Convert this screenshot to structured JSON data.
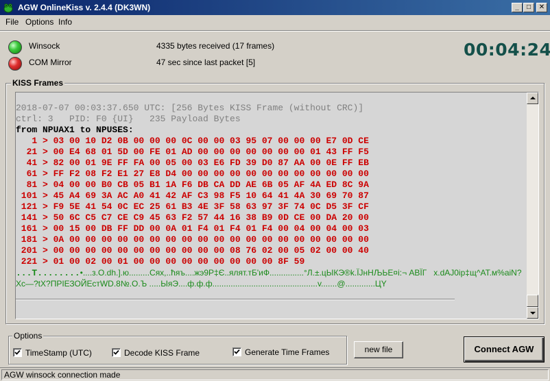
{
  "window": {
    "title": "AGW OnlineKiss v. 2.4.4  (DK3WN)",
    "minimize": "_",
    "maximize": "□",
    "close": "✕"
  },
  "menu": {
    "file": "File",
    "options": "Options",
    "info": "Info"
  },
  "status": {
    "winsock_label": "Winsock",
    "winsock_info": "4335 bytes received (17 frames)",
    "com_label": "COM Mirror",
    "com_info": "47 sec since last packet [5]",
    "timer": "00:04:24",
    "winsock_color": "#3cc83c",
    "com_color": "#e03030"
  },
  "kiss": {
    "title": "KISS Frames",
    "header_line": "2018-07-07 00:03:37.650 UTC: [256 Bytes KISS Frame (without CRC)]",
    "ctrl_line": "ctrl: 3   PID: F0 {UI}   235 Payload Bytes",
    "from_line": "from NPUAX1 to NPUSES:",
    "hex_rows": [
      "   1 > 03 00 10 D2 0B 00 00 00 0C 00 00 03 95 07 00 00 00 E7 0D CE",
      "  21 > 00 E4 68 01 5D 00 FE 01 AD 00 00 00 00 00 00 00 01 43 FF F5",
      "  41 > 82 00 01 9E FF FA 00 05 00 03 E6 FD 39 D0 87 AA 00 0E FF EB",
      "  61 > FF F2 08 F2 E1 27 E8 D4 00 00 00 00 00 00 00 00 00 00 00 00",
      "  81 > 04 00 00 B0 CB 05 B1 1A F6 DB CA DD AE 6B 05 AF 4A ED 8C 9A",
      " 101 > 45 A4 69 3A AC A0 41 42 AF C3 98 F5 10 64 41 4A 30 69 70 87",
      " 121 > F9 5E 41 54 0C EC 25 61 B3 4E 3F 58 63 97 3F 74 0C D5 3F CF",
      " 141 > 50 6C C5 C7 CE C9 45 63 F2 57 44 16 38 B9 0D CE 00 DA 20 00",
      " 161 > 00 15 00 DB FF DD 00 0A 01 F4 01 F4 01 F4 00 04 00 04 00 03",
      " 181 > 0A 00 00 00 00 00 00 00 00 00 00 00 00 00 00 00 00 00 00 00",
      " 201 > 00 00 00 00 00 00 00 00 00 00 00 08 76 02 00 05 02 00 00 40",
      " 221 > 01 00 02 00 01 00 00 00 00 00 00 00 00 00 8F 59"
    ],
    "ascii_line1_start": "...T........",
    "ascii_line1_rest": "•....з.О.dh.].ю.........Сях,..ћяъ....жэ9Р‡Є..ялят.тБ'иФ...............°Л.±.цЫКЭ®k.ЇJнНЉЬЕ¤i:¬ АВЇГ   x.dAJ0ip‡щ^AT.м%aiN?",
    "ascii_line2": "Хс—?tX?ПРІЕЗОЙЕстWD.8№.О.Ъ .....ЫяЭ....ф.ф.ф..............................................v.......@.............ЦY"
  },
  "options": {
    "title": "Options",
    "timestamp_label": "TimeStamp (UTC)",
    "decode_label": "Decode KISS Frame",
    "timeframes_label": "Generate Time Frames",
    "new_file": "new file",
    "connect": "Connect AGW"
  },
  "statusbar": {
    "text": "AGW winsock connection made"
  }
}
